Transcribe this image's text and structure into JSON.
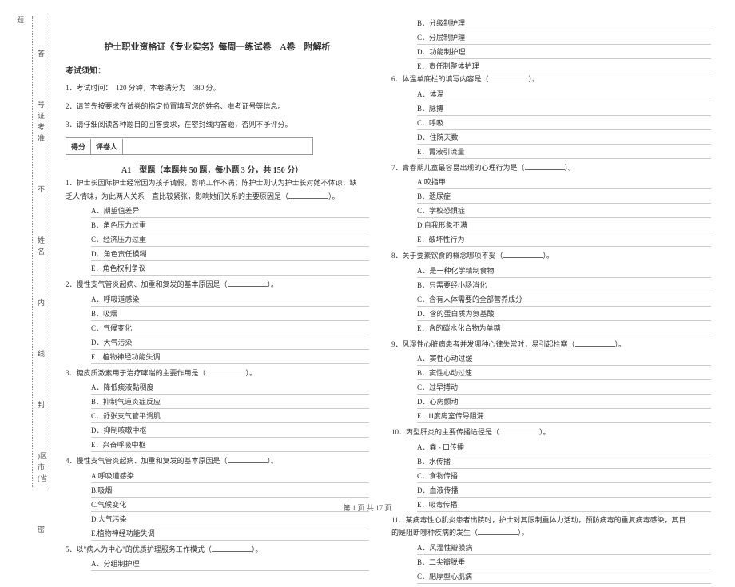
{
  "vertical": {
    "col1": [
      "题",
      "答",
      "号证考准",
      "不",
      "姓名",
      "内",
      "线",
      "封",
      ")区市(省",
      "密"
    ],
    "col2_dots": "…"
  },
  "header": {
    "title": "护士职业资格证《专业实务》每周一练试卷　A卷　附解析",
    "notice_heading": "考试须知：",
    "notice1": "1．考试时间：　120 分钟，本卷满分为　380 分。",
    "notice2": "2．请首先按要求在试卷的指定位置填写您的姓名、准考证号等信息。",
    "notice3": "3．请仔细阅读各种题目的回答要求，在密封线内答题，否则不予评分。"
  },
  "score": {
    "label1": "得分",
    "label2": "评卷人"
  },
  "sectionA": "A1　型题（本题共 50 题，每小题 3 分，共 150 分）",
  "q1": {
    "stem1": "1．护士长因际护士经常因为孩子请假，影响工作不满；陈护士则认为护士长对她不体谅，缺",
    "stem2": "乏人情味，为此两人关系一直比较紧张，影响她们关系的主要原因是（",
    "tail": "）。",
    "opts": [
      "A．期望值差异",
      "B．角色压力过重",
      "C．经济压力过重",
      "D．角色责任模糊",
      "E．角色权利争议"
    ]
  },
  "q2": {
    "stem": "2．慢性支气管炎起病、加重和复发的基本原因是（",
    "tail": "）。",
    "opts": [
      "A．呼吸道感染",
      "B．吸烟",
      "C．气候变化",
      "D．大气污染",
      "E．植物神经功能失调"
    ]
  },
  "q3": {
    "stem": "3．糖皮质激素用于治疗哮喘的主要作用是（",
    "tail": "）。",
    "opts": [
      "A．降低痰液黏稠度",
      "B．抑制气道炎症反应",
      "C．舒张支气管平滑肌",
      "D．抑制咳嗽中枢",
      "E．兴奋呼吸中枢"
    ]
  },
  "q4": {
    "stem": "4．慢性支气管炎起病、加重和复发的基本原因是（",
    "tail": "）。",
    "opts": [
      "A.呼吸道感染",
      "B.吸烟",
      "C.气候变化",
      "D.大气污染",
      "E.植物神经功能失调"
    ]
  },
  "q5": {
    "stem": "5．以\"病人为中心\"的优质护理服务工作模式（",
    "tail": "）。",
    "opts": [
      "A．分组制护理"
    ]
  },
  "q5r_opts": [
    "B．分级制护理",
    "C．分层制护理",
    "D．功能制护理",
    "E．责任制整体护理"
  ],
  "q6": {
    "stem": "6．体温单底栏的填写内容是（",
    "tail": "）。",
    "opts": [
      "A．体温",
      "B．脉搏",
      "C．呼吸",
      "D．住院天数",
      "E．胃液引流量"
    ]
  },
  "q7": {
    "stem": "7．青春期儿童最容易出现的心理行为是（",
    "tail": "）。",
    "opts": [
      "A.咬指甲",
      "B．遗尿症",
      "C．学校恐惧症",
      "D.自我形象不满",
      "E．破坏性行为"
    ]
  },
  "q8": {
    "stem": "8．关于要素饮食的概念哪项不妥（",
    "tail": "）。",
    "opts": [
      "A．是一种化学精制食物",
      "B．只需要经小肠消化",
      "C．含有人体需要的全部营养成分",
      "D．含的蛋白质为氨基酸",
      "E．含的碳水化合物为单糖"
    ]
  },
  "q9": {
    "stem": "9．风湿性心脏病患者并发哪种心律失常时，易引起栓塞（",
    "tail": "）。",
    "opts": [
      "A．窦性心动过缓",
      "B．窦性心动过速",
      "C．过早搏动",
      "D．心房颤动",
      "E．Ⅲ度房室传导阻滞"
    ]
  },
  "q10": {
    "stem": "10．丙型肝炎的主要传播途径是（",
    "tail": "）。",
    "opts": [
      "A．粪 - 口传播",
      "B．水传播",
      "C．食物传播",
      "D．血液传播",
      "E．吸毒传播"
    ]
  },
  "q11": {
    "stem1": "11．某病毒性心肌炎患者出院时，护士对其限制重体力活动，预防病毒的重复病毒感染，其目",
    "stem2": "的是阻断哪种疾病的发生（",
    "tail": "）。",
    "opts": [
      "A．风湿性瓣膜病",
      "B．二尖瓣脱垂",
      "C．肥厚型心肌病"
    ]
  },
  "footer": "第 1 页 共 17 页"
}
